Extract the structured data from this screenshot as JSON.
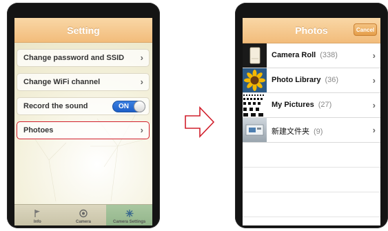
{
  "settings": {
    "title": "Setting",
    "rows": [
      {
        "label": "Change password and SSID"
      },
      {
        "label": "Change WiFi channel"
      },
      {
        "label": "Record the sound",
        "toggle": "ON"
      },
      {
        "label": "Photoes"
      }
    ],
    "tabs": [
      {
        "label": "Info",
        "icon": "flag-icon"
      },
      {
        "label": "Camera",
        "icon": "camera-lens-icon"
      },
      {
        "label": "Camera Settings",
        "icon": "camera-settings-icon"
      }
    ],
    "highlight_color": "#d11e2b"
  },
  "photos": {
    "title": "Photos",
    "cancel_label": "Cancel",
    "albums": [
      {
        "name": "Camera Roll",
        "count": "(338)",
        "thumb": "camera-roll-thumbnail"
      },
      {
        "name": "Photo Library",
        "count": "(36)",
        "thumb": "sunflower-thumbnail"
      },
      {
        "name": "My Pictures",
        "count": "(27)",
        "thumb": "eye-chart-thumbnail"
      },
      {
        "name": "新建文件夹",
        "count": "(9)",
        "thumb": "folder-photo-thumbnail"
      }
    ]
  },
  "colors": {
    "navbar": "#f2bc7b",
    "toggle_on": "#2a6fd6",
    "active_tab": "#a0c197"
  }
}
